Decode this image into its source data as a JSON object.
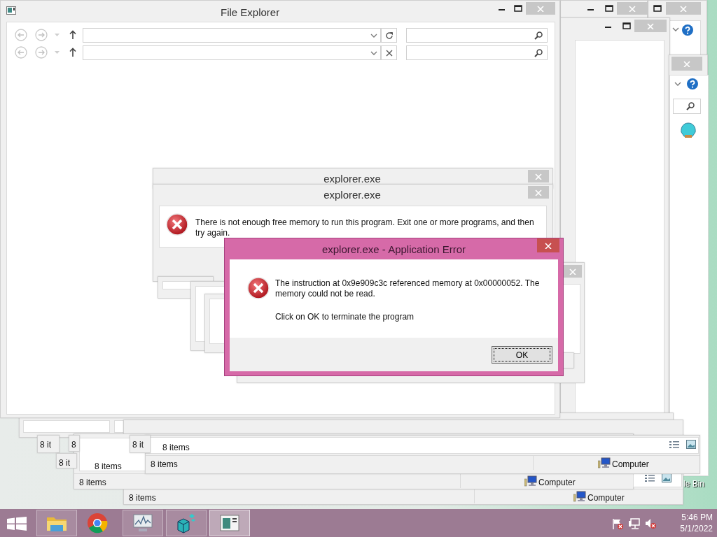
{
  "desktop": {
    "icon_label": "le Bin"
  },
  "folder_windows": [
    {
      "status_text": "8 items",
      "location": "Computer"
    },
    {
      "pane_text": "8 items",
      "status_text": "8 items",
      "location": "Computer",
      "view_icons": true
    },
    {
      "pane_text": "8 items",
      "status_text": "8 items",
      "location": "Computer",
      "view_icons": true
    }
  ],
  "status_fragments": [
    {
      "text": "8 it"
    },
    {
      "text": "8 it"
    },
    {
      "text": "8"
    },
    {
      "text": "8 it"
    }
  ],
  "file_explorer": {
    "title": "File Explorer"
  },
  "message_dialogs": [
    {
      "title": "explorer.exe"
    },
    {
      "title": "explorer.exe",
      "message": "There is not enough free memory to run this program. Exit one or more programs, and then try again."
    }
  ],
  "error_dialog": {
    "title": "explorer.exe - Application Error",
    "message": "The instruction at 0x9e909c3c referenced memory at 0x00000052. The memory could not be read.",
    "note": "Click on OK to terminate the program",
    "button": "OK"
  },
  "taskbar": {
    "apps": [
      {
        "kind": "folder",
        "running": true,
        "selected": false
      },
      {
        "kind": "browser",
        "running": false,
        "selected": false
      },
      {
        "kind": "monitor",
        "running": true,
        "selected": false
      },
      {
        "kind": "cubes",
        "running": true,
        "selected": false
      },
      {
        "kind": "window",
        "running": true,
        "selected": true
      }
    ],
    "clock": {
      "time": "5:46 PM",
      "date": "5/1/2022"
    }
  }
}
